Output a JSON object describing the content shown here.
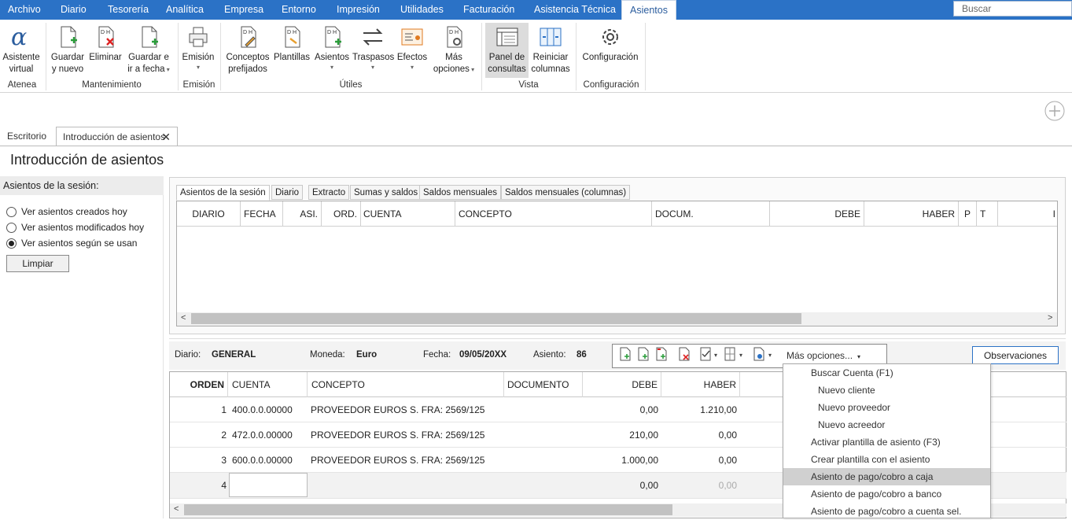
{
  "menubar": {
    "tabs": [
      "Archivo",
      "Diario",
      "Tesorería",
      "Analítica",
      "Empresa",
      "Entorno",
      "Impresión",
      "Utilidades",
      "Facturación",
      "Asistencia Técnica",
      "Asientos"
    ],
    "active": "Asientos",
    "search_placeholder": "Buscar"
  },
  "ribbon": {
    "buttons": {
      "asistente": [
        "Asistente",
        "virtual"
      ],
      "guardar_nuevo": [
        "Guardar",
        "y nuevo"
      ],
      "eliminar": [
        "Eliminar"
      ],
      "guardar_fecha": [
        "Guardar e",
        "ir a fecha"
      ],
      "emision": [
        "Emisión"
      ],
      "conceptos": [
        "Conceptos",
        "prefijados"
      ],
      "plantillas": [
        "Plantillas"
      ],
      "asientos": [
        "Asientos"
      ],
      "traspasos": [
        "Traspasos"
      ],
      "efectos": [
        "Efectos"
      ],
      "mas_opciones": [
        "Más",
        "opciones"
      ],
      "panel": [
        "Panel de",
        "consultas"
      ],
      "reiniciar": [
        "Reiniciar",
        "columnas"
      ],
      "configuracion": [
        "Configuración"
      ]
    },
    "groups": {
      "atenea": "Atenea",
      "mantenimiento": "Mantenimiento",
      "emision": "Emisión",
      "utiles": "Útiles",
      "vista": "Vista",
      "configuracion": "Configuración"
    }
  },
  "doc_tabs": {
    "escritorio": "Escritorio",
    "intro": "Introducción de asientos"
  },
  "page_title": "Introducción de asientos",
  "session": {
    "header": "Asientos de la sesión:",
    "options": [
      "Ver asientos creados hoy",
      "Ver asientos modificados hoy",
      "Ver asientos según se usan"
    ],
    "selected_index": 2,
    "clear_button": "Limpiar"
  },
  "inner_tabs": [
    "Asientos de la sesión",
    "Diario",
    "Extracto",
    "Sumas y saldos",
    "Saldos mensuales",
    "Saldos mensuales (columnas)"
  ],
  "top_grid_columns": [
    "DIARIO",
    "FECHA",
    "ASI.",
    "ORD.",
    "CUENTA",
    "CONCEPTO",
    "DOCUM.",
    "DEBE",
    "HABER",
    "P",
    "T",
    "I"
  ],
  "entry": {
    "diario_label": "Diario:",
    "diario_value": "GENERAL",
    "moneda_label": "Moneda:",
    "moneda_value": "Euro",
    "fecha_label": "Fecha:",
    "fecha_value": "09/05/20XX",
    "asiento_label": "Asiento:",
    "asiento_value": "86",
    "mas_opciones": "Más opciones...",
    "observaciones": "Observaciones"
  },
  "lines_grid": {
    "columns": [
      "ORDEN",
      "CUENTA",
      "CONCEPTO",
      "DOCUMENTO",
      "DEBE",
      "HABER"
    ],
    "rows": [
      {
        "orden": "1",
        "cuenta": "400.0.0.00000",
        "concepto": "PROVEEDOR EUROS S. FRA:  2569/125",
        "documento": "",
        "debe": "0,00",
        "haber": "1.210,00"
      },
      {
        "orden": "2",
        "cuenta": "472.0.0.00000",
        "concepto": "PROVEEDOR EUROS S. FRA:  2569/125",
        "documento": "",
        "debe": "210,00",
        "haber": "0,00"
      },
      {
        "orden": "3",
        "cuenta": "600.0.0.00000",
        "concepto": "PROVEEDOR EUROS S. FRA:  2569/125",
        "documento": "",
        "debe": "1.000,00",
        "haber": "0,00"
      },
      {
        "orden": "4",
        "cuenta": "",
        "concepto": "",
        "documento": "",
        "debe": "0,00",
        "haber": "0,00"
      }
    ]
  },
  "dropdown": {
    "items": [
      "Buscar Cuenta (F1)",
      "Nuevo cliente",
      "Nuevo proveedor",
      "Nuevo acreedor",
      "Activar plantilla de asiento (F3)",
      "Crear plantilla con el asiento",
      "Asiento de pago/cobro a caja",
      "Asiento de pago/cobro a banco",
      "Asiento de pago/cobro a cuenta sel."
    ],
    "highlighted_index": 6
  },
  "colors": {
    "menubar": "#2b72c6",
    "highlight": "#d0d0d0"
  }
}
